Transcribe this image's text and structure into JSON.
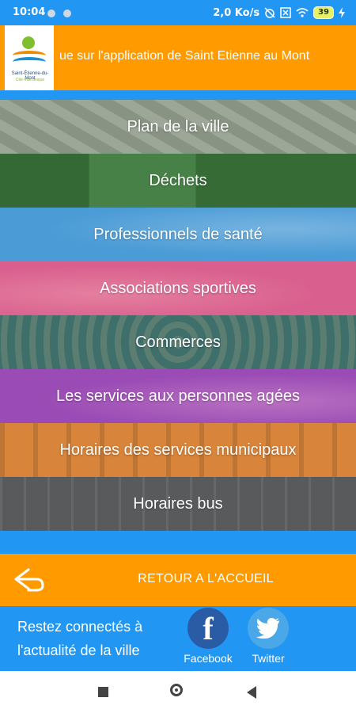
{
  "status_bar": {
    "time": "10:04",
    "network_speed": "2,0 Ko/s",
    "battery": "39"
  },
  "header": {
    "logo_line1": "Saint-Étienne-du-Mont",
    "logo_line2": "Cité-Ville unique",
    "marquee_text": "ue sur l'application de Saint Etienne au Mont"
  },
  "menu": {
    "items": [
      {
        "label": "Plan de la ville"
      },
      {
        "label": "Déchets"
      },
      {
        "label": "Professionnels de santé"
      },
      {
        "label": "Associations sportives"
      },
      {
        "label": "Commerces"
      },
      {
        "label": "Les services aux personnes agées"
      },
      {
        "label": "Horaires des services municipaux"
      },
      {
        "label": "Horaires bus"
      }
    ]
  },
  "home_bar": {
    "label": "RETOUR A L'ACCUEIL",
    "icon": "back-arrow-icon"
  },
  "footer": {
    "line1": "Restez connectés à",
    "line2": "l'actualité de la ville",
    "facebook_label": "Facebook",
    "twitter_label": "Twitter"
  },
  "colors": {
    "orange": "#ff9b00",
    "blue": "#2196f3"
  }
}
